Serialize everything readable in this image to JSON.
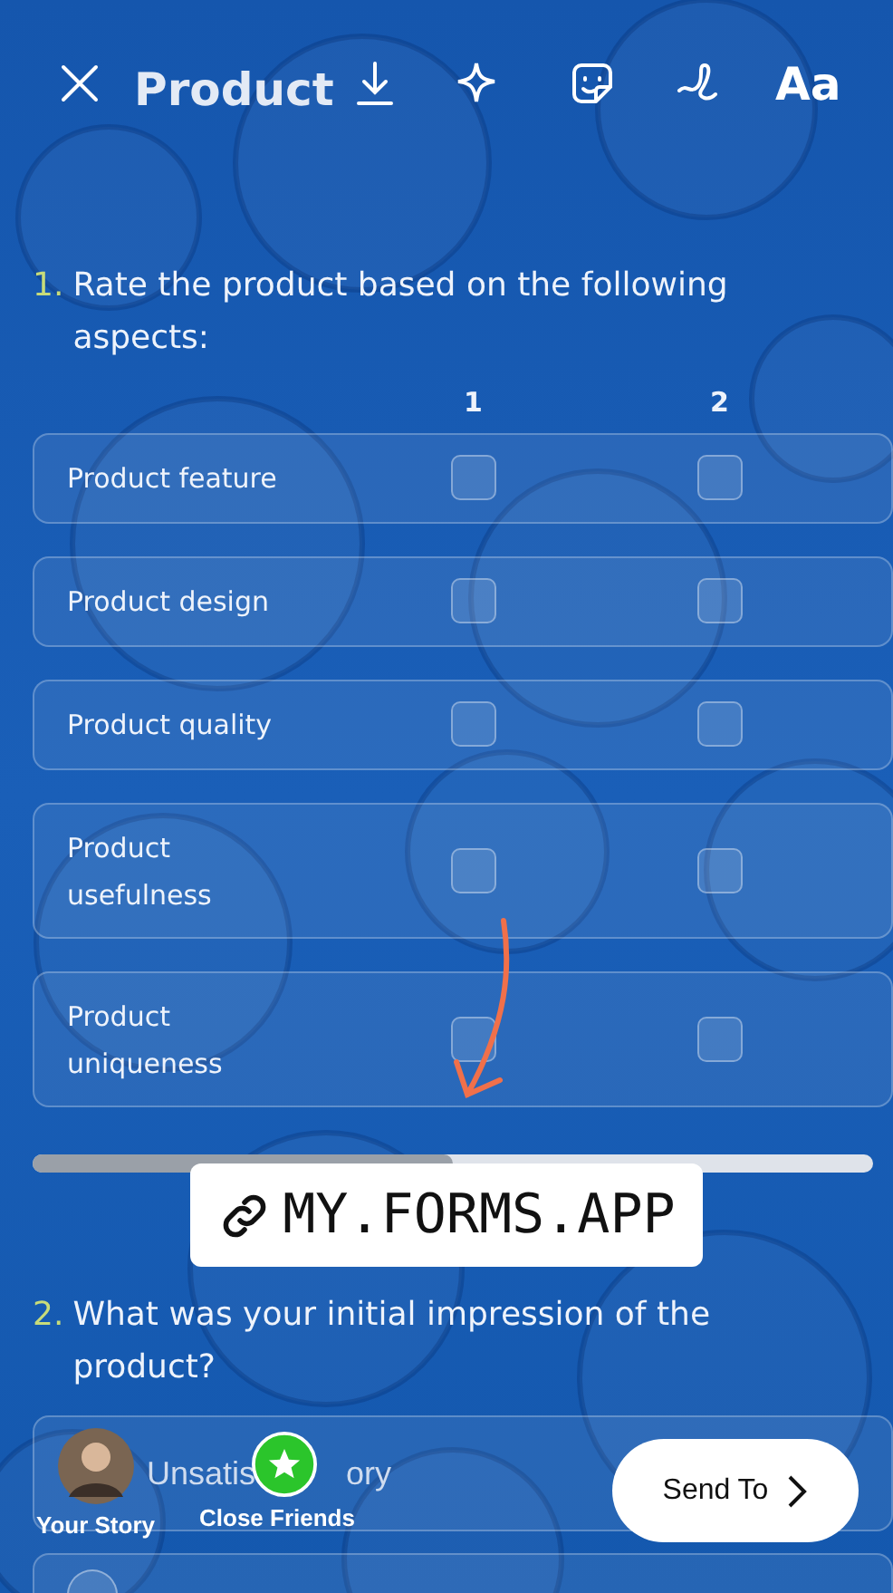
{
  "form": {
    "title": "Product",
    "questions": [
      {
        "number": "1.",
        "text": "Rate the product based on the following aspects:",
        "kind": "matrix",
        "columns": [
          "1",
          "2"
        ],
        "rows": [
          {
            "label": "Product feature",
            "cells": [
              {
                "checked": false
              },
              {
                "checked": false
              }
            ]
          },
          {
            "label": "Product design",
            "cells": [
              {
                "checked": false
              },
              {
                "checked": false
              }
            ]
          },
          {
            "label": "Product quality",
            "cells": [
              {
                "checked": false
              },
              {
                "checked": false
              }
            ]
          },
          {
            "label": "Product usefulness",
            "cells": [
              {
                "checked": false
              },
              {
                "checked": false
              }
            ]
          },
          {
            "label": "Product uniqueness",
            "cells": [
              {
                "checked": false
              },
              {
                "checked": false
              }
            ]
          }
        ],
        "scroll": {
          "level": 0.5
        }
      },
      {
        "number": "2.",
        "text": "What was your initial impression of the product?",
        "kind": "choice",
        "options": [
          {
            "label_parts": [
              "Unsatis",
              "ory"
            ]
          },
          {
            "selected": false
          }
        ]
      }
    ]
  },
  "editor": {
    "text_tool": "Aa",
    "link_sticker": "MY.FORMS.APP"
  },
  "share": {
    "targets": [
      {
        "label": "Your Story",
        "kind": "avatar"
      },
      {
        "label": "Close Friends",
        "kind": "star"
      }
    ],
    "send": "Send To"
  }
}
